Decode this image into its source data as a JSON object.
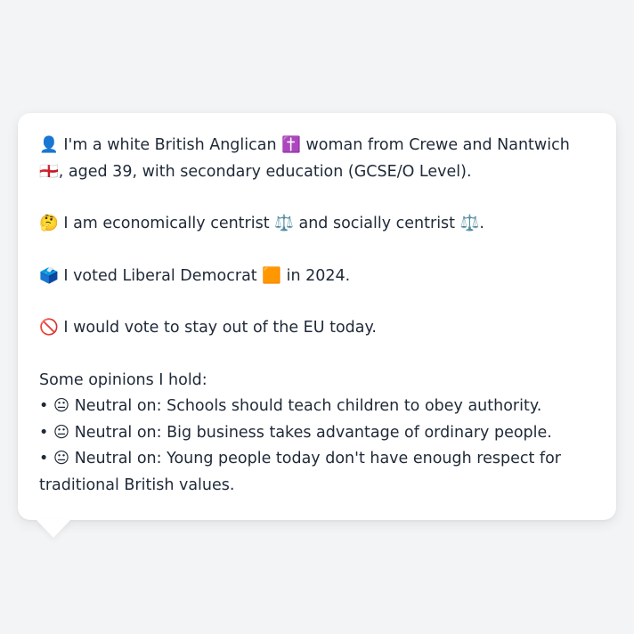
{
  "bio": {
    "line1": "👤 I'm a white British Anglican ✝️ woman from Crewe and Nantwich 🏴󠁧󠁢󠁥󠁮󠁧󠁿, aged 39, with secondary education (GCSE/O Level)."
  },
  "politics": {
    "stance": "🤔 I am economically centrist ⚖️ and socially centrist ⚖️.",
    "vote": "🗳️ I voted Liberal Democrat 🟧 in 2024.",
    "eu": "🚫 I would vote to stay out of the EU today."
  },
  "opinions": {
    "heading": "Some opinions I hold:",
    "items": [
      "• 😐 Neutral on: Schools should teach children to obey authority.",
      "• 😐 Neutral on: Big business takes advantage of ordinary people.",
      "• 😐 Neutral on: Young people today don't have enough respect for traditional British values."
    ]
  }
}
